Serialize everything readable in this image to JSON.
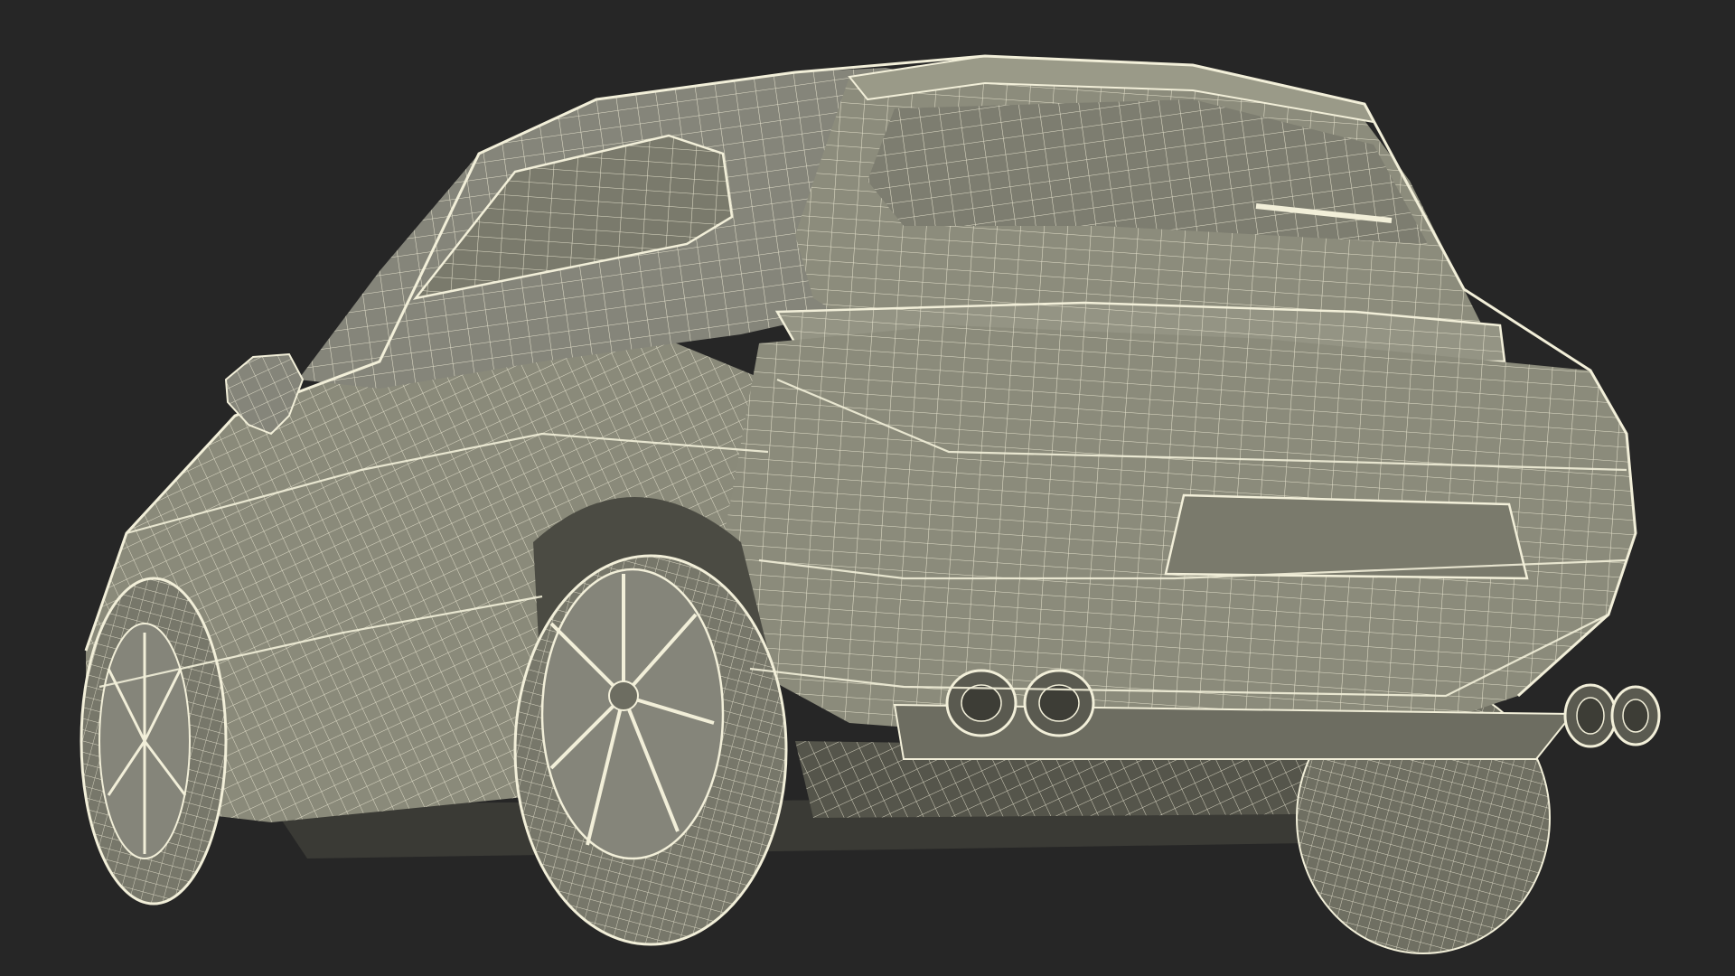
{
  "scene": {
    "subject": "suv-wireframe-rear-three-quarter",
    "colors": {
      "background": "#262626",
      "body_fill": "#8c8c7c",
      "body_shade": "#75756a",
      "wire": "#f2efd9",
      "dark": "#4a4a42"
    }
  }
}
